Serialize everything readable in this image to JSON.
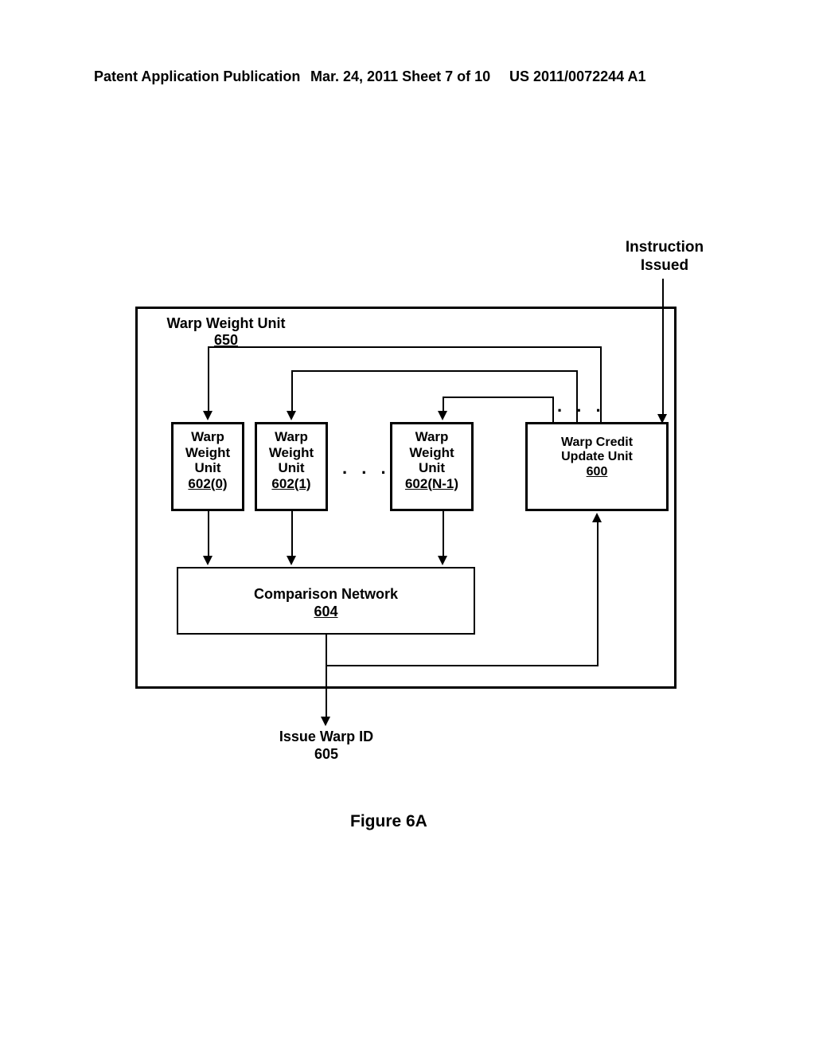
{
  "header": {
    "left": "Patent Application Publication",
    "mid": "Mar. 24, 2011  Sheet 7 of 10",
    "right": "US 2011/0072244 A1"
  },
  "instruction_issued": "Instruction Issued",
  "outer": {
    "title": "Warp Weight Unit",
    "num": "650"
  },
  "units": {
    "wwu0": {
      "l1": "Warp",
      "l2": "Weight",
      "l3": "Unit",
      "num": "602(0)"
    },
    "wwu1": {
      "l1": "Warp",
      "l2": "Weight",
      "l3": "Unit",
      "num": "602(1)"
    },
    "wwun": {
      "l1": "Warp",
      "l2": "Weight",
      "l3": "Unit",
      "num": "602(N-1)"
    },
    "credit": {
      "l1": "Warp Credit",
      "l2": "Update Unit",
      "num": "600"
    }
  },
  "ellipsis": ". . .",
  "comp": {
    "title": "Comparison Network",
    "num": "604"
  },
  "output": {
    "title": "Issue Warp ID",
    "num": "605"
  },
  "figure": "Figure 6A"
}
